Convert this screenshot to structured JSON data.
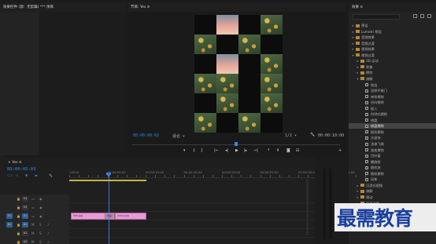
{
  "source_panel": {
    "tab": "效果控件 (源：无剪辑) *** 项目"
  },
  "program": {
    "tab_label": "节目: Yes ≡",
    "timecode_left": "00:00:00:02",
    "fit": "适合 ▾",
    "quality": "1/2 ▾",
    "timecode_right": "00:00:10:00"
  },
  "effects": {
    "tab_label": "效果 ≡",
    "tree": [
      {
        "label": "预设",
        "level": 1,
        "type": "folder",
        "open": false
      },
      {
        "label": "Lumetri 预设",
        "level": 1,
        "type": "folder",
        "open": false
      },
      {
        "label": "音频效果",
        "level": 1,
        "type": "folder",
        "open": false
      },
      {
        "label": "音频过渡",
        "level": 1,
        "type": "folder",
        "open": false
      },
      {
        "label": "视频效果",
        "level": 1,
        "type": "folder",
        "open": false
      },
      {
        "label": "视频过渡",
        "level": 1,
        "type": "folder",
        "open": true
      },
      {
        "label": "3D 运动",
        "level": 2,
        "type": "folder",
        "open": false
      },
      {
        "label": "划像",
        "level": 2,
        "type": "folder",
        "open": false
      },
      {
        "label": "擦除",
        "level": 2,
        "type": "folder",
        "open": false
      },
      {
        "label": "溶解",
        "level": 2,
        "type": "folder",
        "open": true
      },
      {
        "label": "划出",
        "level": 3,
        "type": "effect"
      },
      {
        "label": "双侧平推门",
        "level": 3,
        "type": "effect"
      },
      {
        "label": "带状擦除",
        "level": 3,
        "type": "effect"
      },
      {
        "label": "径向擦除",
        "level": 3,
        "type": "effect"
      },
      {
        "label": "插入",
        "level": 3,
        "type": "effect"
      },
      {
        "label": "时钟式擦除",
        "level": 3,
        "type": "effect"
      },
      {
        "label": "棋盘",
        "level": 3,
        "type": "effect"
      },
      {
        "label": "棋盘擦除",
        "level": 3,
        "type": "effect",
        "selected": true
      },
      {
        "label": "楔形擦除",
        "level": 3,
        "type": "effect"
      },
      {
        "label": "水波块",
        "level": 3,
        "type": "effect"
      },
      {
        "label": "油漆飞溅",
        "level": 3,
        "type": "effect"
      },
      {
        "label": "渐变擦除",
        "level": 3,
        "type": "effect"
      },
      {
        "label": "百叶窗",
        "level": 3,
        "type": "effect"
      },
      {
        "label": "螺旋框",
        "level": 3,
        "type": "effect"
      },
      {
        "label": "随机块",
        "level": 3,
        "type": "effect"
      },
      {
        "label": "随机擦除",
        "level": 3,
        "type": "effect"
      },
      {
        "label": "风车",
        "level": 3,
        "type": "effect"
      },
      {
        "label": "沉浸式视频",
        "level": 2,
        "type": "folder",
        "open": false
      },
      {
        "label": "溶解",
        "level": 2,
        "type": "folder",
        "open": false
      },
      {
        "label": "滑动",
        "level": 2,
        "type": "folder",
        "open": false
      },
      {
        "label": "页面剥落",
        "level": 2,
        "type": "folder",
        "open": false
      }
    ],
    "bottom_rows": [
      "基本图形",
      "库",
      "标记"
    ]
  },
  "timeline": {
    "tab_label": "× Yes ≡",
    "timecode": "00:00:05:03",
    "ruler_ticks": [
      ":00:00",
      "00:00:05:00",
      "00:00:10:00",
      "00:00:15:00",
      "00:00:20:00",
      "00:00:25:00",
      "00:00:30:00",
      "00:00:35:00"
    ],
    "tracks": [
      {
        "id": "V3",
        "kind": "video"
      },
      {
        "id": "V2",
        "kind": "video"
      },
      {
        "id": "V1",
        "kind": "video",
        "src": "V1"
      },
      {
        "id": "A1",
        "kind": "audio",
        "src": "A1"
      },
      {
        "id": "A2",
        "kind": "audio"
      },
      {
        "id": "A3",
        "kind": "audio"
      }
    ],
    "clips": [
      {
        "label": "Yes.jpg",
        "track": "V1"
      },
      {
        "label": "xxxx.jpg",
        "track": "V1"
      }
    ],
    "transition_label": "棋盘"
  },
  "watermark": "最需教育",
  "colors": {
    "accent": "#2d8ceb",
    "clip": "#e89ad6",
    "selection": "#444444",
    "watermark": "#1a3f9e"
  }
}
